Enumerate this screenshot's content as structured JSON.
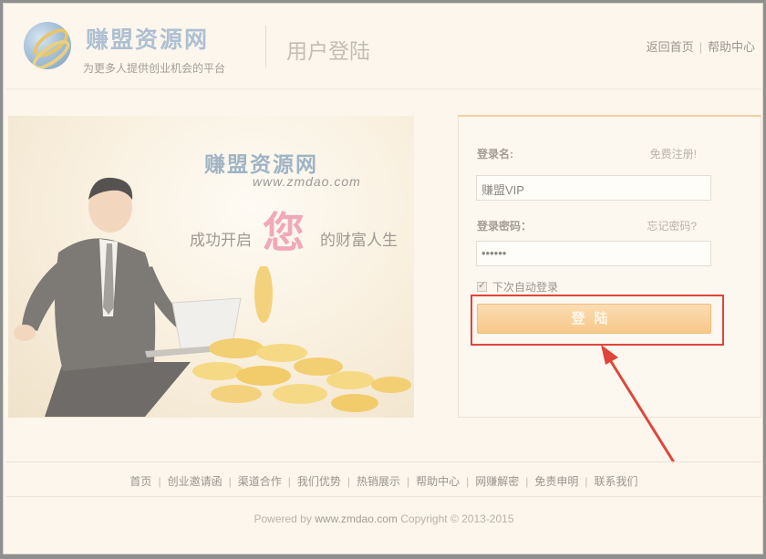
{
  "header": {
    "logo_text": "赚盟资源网",
    "slogan": "为更多人提供创业机会的平台",
    "page_title": "用户登陆",
    "links": [
      "返回首页",
      "帮助中心"
    ]
  },
  "banner": {
    "brand": "赚盟资源网",
    "url": "www.zmdao.com",
    "slogan_prefix": "成功开启",
    "slogan_highlight": "您",
    "slogan_suffix": "的财富人生"
  },
  "login": {
    "username_label": "登录名:",
    "register_link": "免费注册!",
    "username_value": "赚盟VIP",
    "password_label": "登录密码：",
    "forgot_link": "忘记密码?",
    "password_value": "••••••",
    "remember_label": "下次自动登录",
    "remember_checked": true,
    "submit_label": "登陆"
  },
  "footer": {
    "links": [
      "首页",
      "创业邀请函",
      "渠道合作",
      "我们优势",
      "热销展示",
      "帮助中心",
      "网赚解密",
      "免责申明",
      "联系我们"
    ],
    "powered_prefix": "Powered by",
    "powered_site": "www.zmdao.com",
    "copyright": "Copyright © 2013-2015"
  },
  "colors": {
    "accent": "#f7c88a",
    "highlight": "#e0453b",
    "background": "#fcf6ec"
  }
}
